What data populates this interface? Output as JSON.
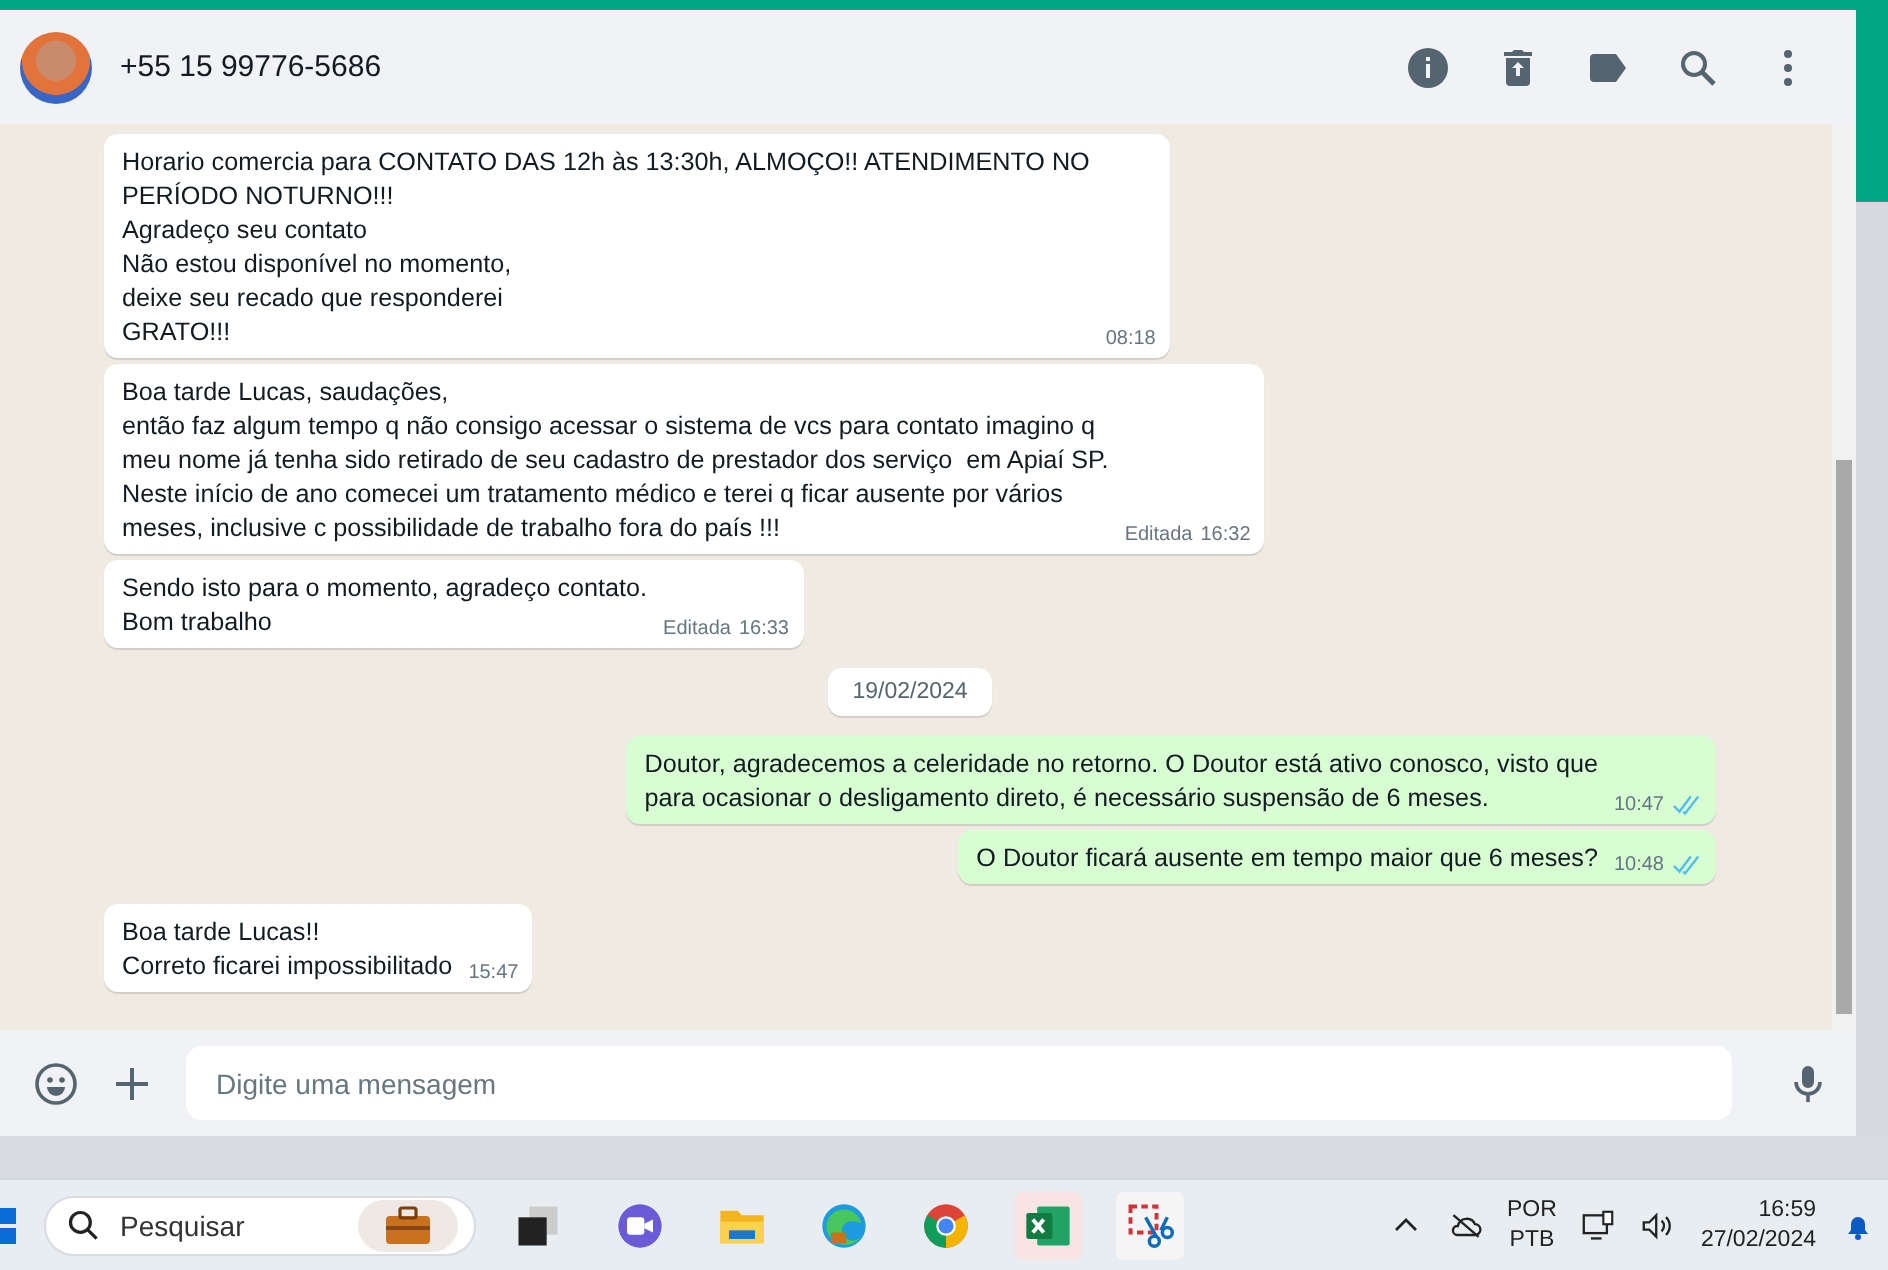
{
  "chat_header": {
    "contact": "+55 15 99776-5686"
  },
  "messages": [
    {
      "kind": "message",
      "outgoing": false,
      "text": "Horario comercia para CONTATO DAS 12h às 13:30h, ALMOÇO!! ATENDIMENTO NO\nPERÍODO NOTURNO!!!\nAgradeço seu contato\nNão estou disponível no momento,\ndeixe seu recado que responderei\nGRATO!!!",
      "time": "08:18"
    },
    {
      "kind": "message",
      "outgoing": false,
      "text": "Boa tarde Lucas, saudações,\nentão faz algum tempo q não consigo acessar o sistema de vcs para contato imagino q\nmeu nome já tenha sido retirado de seu cadastro de prestador dos serviço  em Apiaí SP.\nNeste início de ano comecei um tratamento médico e terei q ficar ausente por vários\nmeses, inclusive c possibilidade de trabalho fora do país !!!",
      "edited": "Editada",
      "time": "16:32"
    },
    {
      "kind": "message",
      "outgoing": false,
      "text": "Sendo isto para o momento, agradeço contato.\nBom trabalho",
      "edited": "Editada",
      "time": "16:33"
    },
    {
      "kind": "date",
      "text": "19/02/2024"
    },
    {
      "kind": "message",
      "outgoing": true,
      "text": "Doutor, agradecemos a celeridade no retorno. O Doutor está ativo conosco, visto que\npara ocasionar o desligamento direto, é necessário suspensão de 6 meses.",
      "time": "10:47",
      "read": true
    },
    {
      "kind": "message",
      "outgoing": true,
      "text": "O Doutor ficará ausente em tempo maior que 6 meses?",
      "time": "10:48",
      "read": true
    },
    {
      "kind": "message",
      "outgoing": false,
      "text": "Boa tarde Lucas!!\nCorreto ficarei impossibilitado",
      "time": "15:47"
    }
  ],
  "composer": {
    "placeholder": "Digite uma mensagem"
  },
  "taskbar": {
    "search_placeholder": "Pesquisar",
    "language": "POR",
    "layout": "PTB",
    "time": "16:59",
    "date": "27/02/2024"
  }
}
